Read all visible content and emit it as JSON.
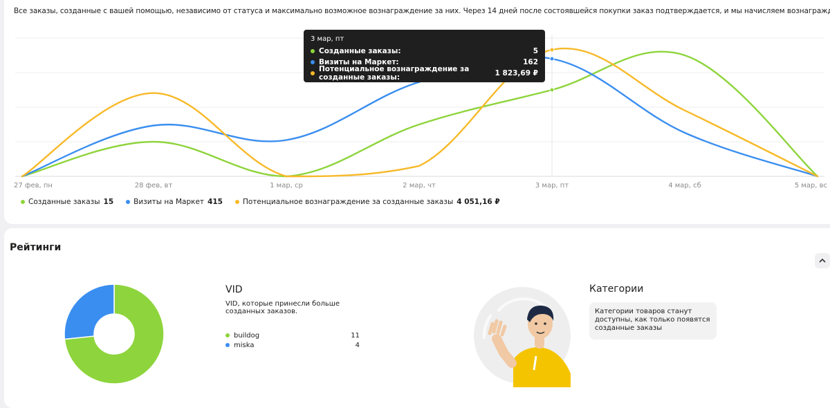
{
  "intro_text": "Все заказы, созданные с вашей помощью, независимо от статуса и максимально возможное вознаграждение за них. Через 14 дней после состоявшейся покупки заказ подтверждается, и мы начисляем вознаграждение.",
  "chart_data": {
    "type": "line",
    "x": [
      "27 фев, пн",
      "28 фев, вт",
      "1 мар, ср",
      "2 мар, чт",
      "3 мар, пт",
      "4 мар, сб",
      "5 мар, вс"
    ],
    "series": [
      {
        "name": "Созданные заказы",
        "color": "#8ed43c",
        "values": [
          0,
          2,
          0,
          3,
          5,
          7,
          0
        ]
      },
      {
        "name": "Визиты на Маркет",
        "color": "#3a8ef0",
        "values": [
          0,
          70,
          50,
          130,
          162,
          60,
          0
        ]
      },
      {
        "name": "Потенциальное вознаграждение за созданные заказы",
        "color": "#f7b928",
        "values": [
          0,
          1200,
          0,
          150,
          1823.69,
          950,
          0
        ]
      }
    ],
    "grid": true,
    "legend_position": "bottom-left"
  },
  "legend": [
    {
      "label": "Созданные заказы",
      "total": "15",
      "color": "#8ed43c"
    },
    {
      "label": "Визиты на Маркет",
      "total": "415",
      "color": "#3a8ef0"
    },
    {
      "label": "Потенциальное вознаграждение за созданные заказы",
      "total": "4 051,16 ₽",
      "color": "#f7b928"
    }
  ],
  "tooltip": {
    "date": "3 мар, пт",
    "rows": [
      {
        "label": "Созданные заказы:",
        "value": "5",
        "color": "#8ed43c"
      },
      {
        "label": "Визиты на Маркет:",
        "value": "162",
        "color": "#3a8ef0"
      },
      {
        "label": "Потенциальное вознаграждение за созданные заказы:",
        "value": "1 823,69 ₽",
        "color": "#f7b928"
      }
    ]
  },
  "ratings": {
    "title": "Рейтинги",
    "collapse_icon": "chevron-up-icon",
    "vid": {
      "title": "VID",
      "description": "VID, которые принесли больше созданных заказов.",
      "items": [
        {
          "name": "buildog",
          "value": 11,
          "color": "#8ed43c"
        },
        {
          "name": "miska",
          "value": 4,
          "color": "#3a8ef0"
        }
      ]
    },
    "categories": {
      "title": "Категории",
      "message": "Категории товаров станут доступны, как только появятся созданные заказы"
    }
  }
}
